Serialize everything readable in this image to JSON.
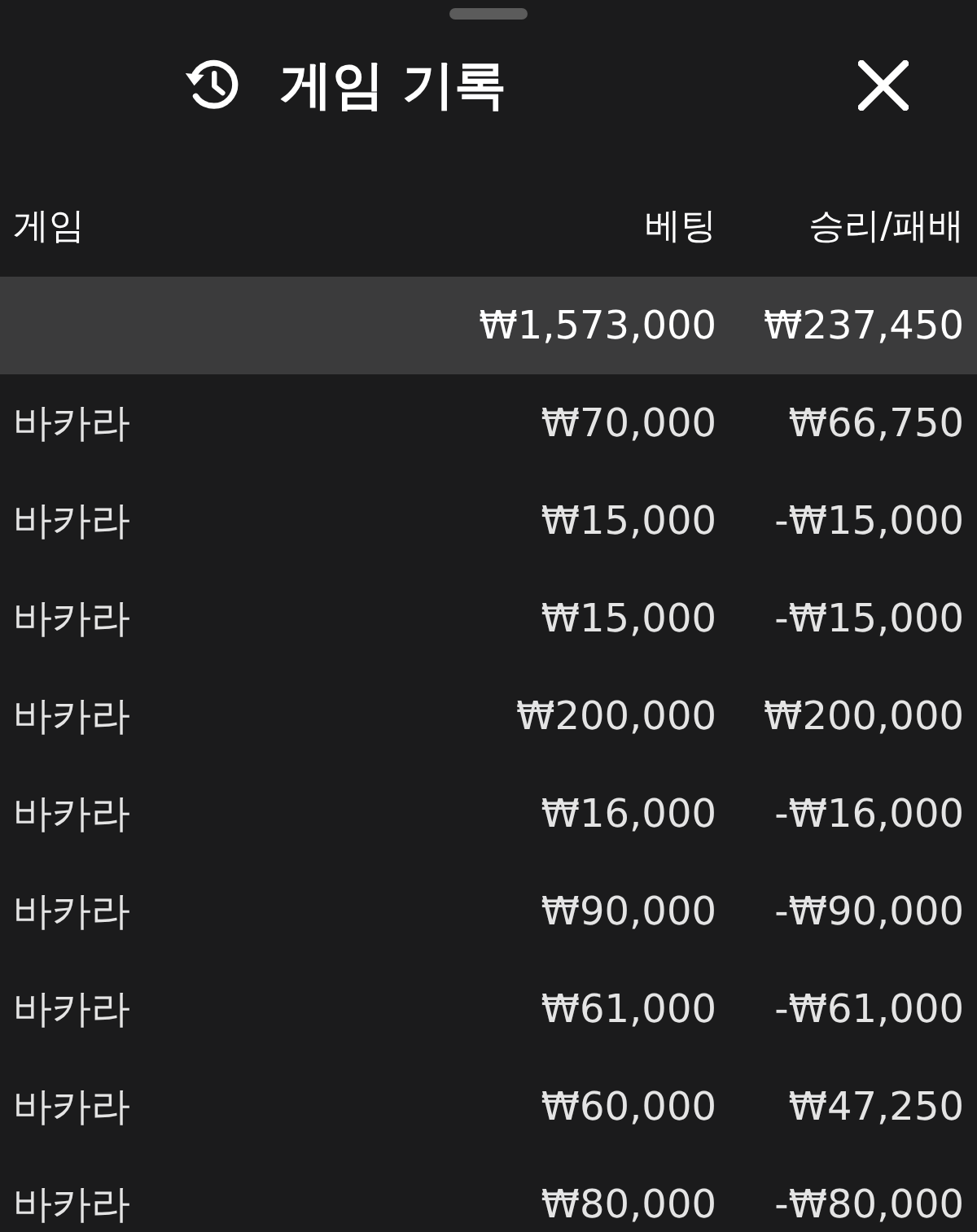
{
  "header": {
    "title": "게임 기록"
  },
  "columns": [
    "게임",
    "베팅",
    "승리/패배"
  ],
  "summary": {
    "bet": "₩1,573,000",
    "result": "₩237,450"
  },
  "rows": [
    {
      "game": "바카라",
      "bet": "₩70,000",
      "result": "₩66,750"
    },
    {
      "game": "바카라",
      "bet": "₩15,000",
      "result": "-₩15,000"
    },
    {
      "game": "바카라",
      "bet": "₩15,000",
      "result": "-₩15,000"
    },
    {
      "game": "바카라",
      "bet": "₩200,000",
      "result": "₩200,000"
    },
    {
      "game": "바카라",
      "bet": "₩16,000",
      "result": "-₩16,000"
    },
    {
      "game": "바카라",
      "bet": "₩90,000",
      "result": "-₩90,000"
    },
    {
      "game": "바카라",
      "bet": "₩61,000",
      "result": "-₩61,000"
    },
    {
      "game": "바카라",
      "bet": "₩60,000",
      "result": "₩47,250"
    },
    {
      "game": "바카라",
      "bet": "₩80,000",
      "result": "-₩80,000"
    }
  ]
}
